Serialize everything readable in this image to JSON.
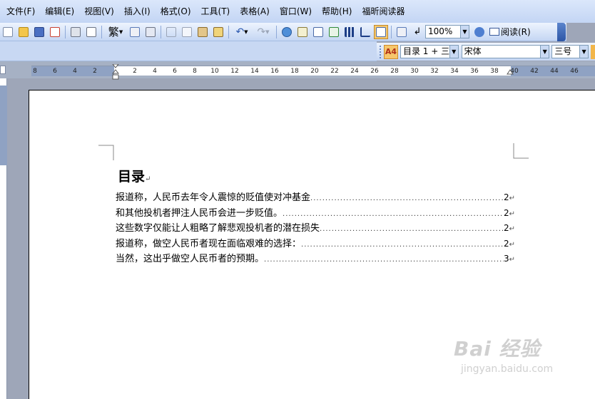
{
  "menubar": {
    "items": [
      "文件(F)",
      "编辑(E)",
      "视图(V)",
      "插入(I)",
      "格式(O)",
      "工具(T)",
      "表格(A)",
      "窗口(W)",
      "帮助(H)",
      "福昕阅读器"
    ]
  },
  "toolbar": {
    "simplified_chinese_label": "繁",
    "zoom_value": "100%",
    "read_label": "阅读(R)"
  },
  "formatting": {
    "style_icon_label": "A4",
    "style_value": "目录 1 + 三",
    "font_value": "宋体",
    "size_value": "三号"
  },
  "ruler": {
    "ticks": [
      "8",
      "6",
      "4",
      "2",
      "2",
      "4",
      "6",
      "8",
      "10",
      "12",
      "14",
      "16",
      "18",
      "20",
      "22",
      "24",
      "26",
      "28",
      "30",
      "32",
      "34",
      "36",
      "38",
      "40",
      "42",
      "44",
      "46"
    ]
  },
  "document": {
    "toc_title": "目录",
    "paragraph_mark": "↵",
    "toc_entries": [
      {
        "text": "报道称，人民币去年令人震惊的贬值使对冲基金",
        "page": "2"
      },
      {
        "text": "和其他投机者押注人民币会进一步贬值。",
        "page": "2"
      },
      {
        "text": "这些数字仅能让人粗略了解悲观投机者的潜在损失",
        "page": "2"
      },
      {
        "text": "报道称，做空人民币者现在面临艰难的选择：",
        "page": "2"
      },
      {
        "text": "当然，这出乎做空人民币者的预期。",
        "page": "3"
      }
    ]
  },
  "watermark": {
    "brand": "Bai 经验",
    "url": "jingyan.baidu.com"
  }
}
